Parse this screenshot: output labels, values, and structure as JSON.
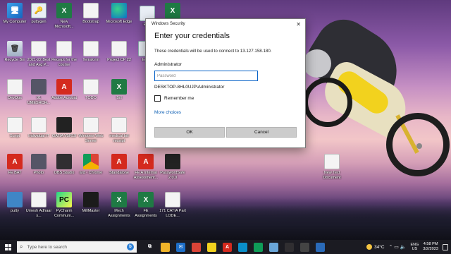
{
  "desktop": {
    "icons": [
      {
        "label": "My Computer",
        "glyph": "🖥",
        "style": "g-pc",
        "icon": "computer-icon"
      },
      {
        "label": "puttygen",
        "glyph": "🔑",
        "style": "g-exe",
        "icon": "puttygen-icon"
      },
      {
        "label": "New Microsoft...",
        "glyph": "X",
        "style": "g-xl",
        "icon": "excel-icon"
      },
      {
        "label": "Bootstrap",
        "glyph": "",
        "style": "g-doc",
        "icon": "document-icon"
      },
      {
        "label": "Microsoft Edge",
        "glyph": "",
        "style": "g-edge",
        "icon": "edge-icon"
      },
      {
        "label": "Ex...",
        "glyph": "",
        "style": "g-exe",
        "icon": "file-icon"
      },
      {
        "label": "",
        "glyph": "X",
        "style": "g-xl",
        "icon": "excel-icon"
      },
      {
        "label": "Recycle Bin",
        "glyph": "🗑",
        "style": "g-bin",
        "icon": "recycle-bin-icon"
      },
      {
        "label": "2021-22 Best and Avg P...",
        "glyph": "",
        "style": "g-doc",
        "icon": "document-icon"
      },
      {
        "label": "Receipt for the course",
        "glyph": "",
        "style": "g-doc",
        "icon": "document-icon"
      },
      {
        "label": "Terraform",
        "glyph": "",
        "style": "g-doc",
        "icon": "document-icon"
      },
      {
        "label": "Project CP 22",
        "glyph": "",
        "style": "g-doc",
        "icon": "document-icon"
      },
      {
        "label": "Ec...",
        "glyph": "",
        "style": "g-exe",
        "icon": "file-icon"
      },
      {
        "label": "DevOps",
        "glyph": "",
        "style": "g-doc",
        "icon": "document-icon"
      },
      {
        "label": "01 UMESHCH...",
        "glyph": "",
        "style": "g-photo",
        "icon": "photo-icon"
      },
      {
        "label": "Adobe Acrobat",
        "glyph": "A",
        "style": "g-pdf",
        "icon": "acrobat-icon"
      },
      {
        "label": "TODO",
        "glyph": "",
        "style": "g-doc",
        "icon": "document-icon"
      },
      {
        "label": "Bill",
        "glyph": "X",
        "style": "g-xl",
        "icon": "excel-icon"
      },
      {
        "label": "Script",
        "glyph": "",
        "style": "g-doc",
        "icon": "document-icon"
      },
      {
        "label": "Individual IT",
        "glyph": "",
        "style": "g-doc",
        "icon": "document-icon"
      },
      {
        "label": "GATIA V5R19",
        "glyph": "",
        "style": "g-pass",
        "icon": "catia-icon"
      },
      {
        "label": "Windows Web Server",
        "glyph": "",
        "style": "g-doc",
        "icon": "document-icon"
      },
      {
        "label": "medical bill receipt",
        "glyph": "",
        "style": "g-doc",
        "icon": "document-icon"
      },
      {
        "label": "FE BAT",
        "glyph": "A",
        "style": "g-pdf",
        "icon": "pdf-icon"
      },
      {
        "label": "Photo",
        "glyph": "",
        "style": "g-photo",
        "icon": "photo-icon"
      },
      {
        "label": "OBS Studio",
        "glyph": "",
        "style": "g-obs",
        "icon": "obs-icon"
      },
      {
        "label": "ard - Chrome",
        "glyph": "",
        "style": "g-chrome",
        "icon": "chrome-icon"
      },
      {
        "label": "Standalone",
        "glyph": "A",
        "style": "g-pdf",
        "icon": "pdf-icon"
      },
      {
        "label": "FE A Internal Assessment...",
        "glyph": "A",
        "style": "g-pdf",
        "icon": "pdf-icon"
      },
      {
        "label": "PasswordSafe 2.0.0",
        "glyph": "",
        "style": "g-pass",
        "icon": "passwordsafe-icon"
      },
      {
        "label": "putty",
        "glyph": "",
        "style": "g-gm",
        "icon": "putty-icon"
      },
      {
        "label": "Umesh Adhaar s...",
        "glyph": "",
        "style": "g-doc",
        "icon": "document-icon"
      },
      {
        "label": "PyCharm Communi...",
        "glyph": "PC",
        "style": "g-pyc",
        "icon": "pycharm-icon"
      },
      {
        "label": "MillMaster",
        "glyph": "",
        "style": "g-vscode",
        "icon": "millmaster-icon"
      },
      {
        "label": "Mech Assignments",
        "glyph": "X",
        "style": "g-xl",
        "icon": "excel-icon"
      },
      {
        "label": "FE Assignments",
        "glyph": "X",
        "style": "g-xl",
        "icon": "excel-icon"
      },
      {
        "label": "171 CATIA Part LODE...",
        "glyph": "",
        "style": "g-doc",
        "icon": "document-icon"
      },
      {
        "label": "New Text Document",
        "glyph": "",
        "style": "g-doc",
        "icon": "text-document-icon"
      }
    ]
  },
  "dialog": {
    "window_title": "Windows Security",
    "close": "✕",
    "heading": "Enter your credentials",
    "message": "These credentials will be used to connect to 13.127.158.180.",
    "username": "Administrator",
    "password_placeholder": "Password",
    "domain_user": "DESKTOP-8HL0UJP\\Administrator",
    "remember_label": "Remember me",
    "more_choices": "More choices",
    "ok_label": "OK",
    "cancel_label": "Cancel"
  },
  "taskbar": {
    "search_placeholder": "Type here to search",
    "bing_glyph": "b",
    "apps": [
      {
        "icon": "task-view-icon",
        "glyph": "⧉",
        "color": "#1b1b22"
      },
      {
        "icon": "file-explorer-icon",
        "glyph": "",
        "color": "#f0b429"
      },
      {
        "icon": "mail-icon",
        "glyph": "✉",
        "color": "#1e6fc8"
      },
      {
        "icon": "chrome-icon",
        "glyph": "",
        "color": "#db4437"
      },
      {
        "icon": "sticky-notes-icon",
        "glyph": "",
        "color": "#f2d21e"
      },
      {
        "icon": "acrobat-icon",
        "glyph": "A",
        "color": "#d42a1e"
      },
      {
        "icon": "edge-icon",
        "glyph": "",
        "color": "#0a8fc9"
      },
      {
        "icon": "chrome-icon",
        "glyph": "",
        "color": "#0f9d58"
      },
      {
        "icon": "notepad-icon",
        "glyph": "",
        "color": "#6aa6d8"
      },
      {
        "icon": "obs-icon",
        "glyph": "",
        "color": "#302e31"
      },
      {
        "icon": "terminal-icon",
        "glyph": "",
        "color": "#444"
      },
      {
        "icon": "remote-desktop-icon",
        "glyph": "",
        "color": "#2a6ab8"
      }
    ],
    "weather_temp": "34°C",
    "tray_symbols": "⌃ ▭ 🔈",
    "lang_1": "ENG",
    "lang_2": "US",
    "time": "4:58 PM",
    "date": "3/2/2023"
  }
}
